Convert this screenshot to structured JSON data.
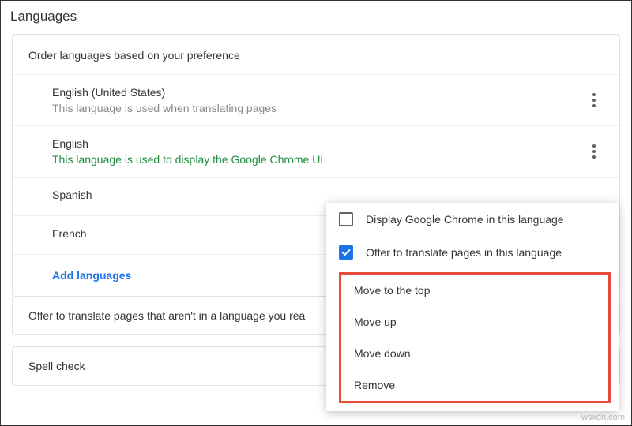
{
  "title": "Languages",
  "order_label": "Order languages based on your preference",
  "langs": [
    {
      "name": "English (United States)",
      "sub": "This language is used when translating pages",
      "green": false,
      "kebab": true
    },
    {
      "name": "English",
      "sub": "This language is used to display the Google Chrome UI",
      "green": true,
      "kebab": true
    },
    {
      "name": "Spanish",
      "sub": "",
      "green": false,
      "kebab": false
    },
    {
      "name": "French",
      "sub": "",
      "green": false,
      "kebab": false
    }
  ],
  "add": "Add languages",
  "translate_offer": "Offer to translate pages that aren't in a language you rea",
  "spell": "Spell check",
  "popup": {
    "chk_display": "Display Google Chrome in this language",
    "chk_offer": "Offer to translate pages in this language",
    "m1": "Move to the top",
    "m2": "Move up",
    "m3": "Move down",
    "m4": "Remove"
  },
  "watermark": "wsxdn.com"
}
